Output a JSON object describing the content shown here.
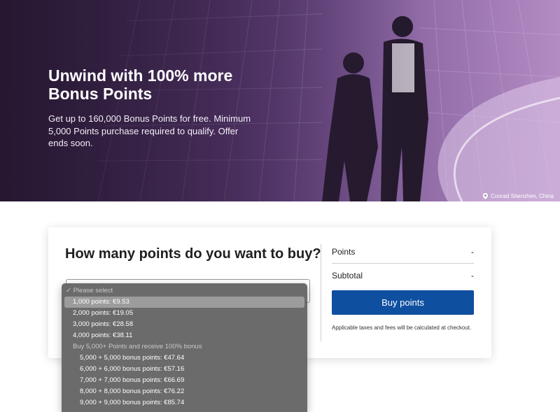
{
  "hero": {
    "title": "Unwind with 100% more Bonus Points",
    "body": "Get up to 160,000 Bonus Points for free. Minimum 5,000 Points purchase required to qualify. Offer ends soon.",
    "photo_credit": "Conrad Shenzhen, China"
  },
  "purchase": {
    "question": "How many points do you want to buy?",
    "summary": {
      "points_label": "Points",
      "points_value": "-",
      "subtotal_label": "Subtotal",
      "subtotal_value": "-"
    },
    "buy_button_label": "Buy points",
    "tax_note": "Applicable taxes and fees will be calculated at checkout."
  },
  "dropdown": {
    "placeholder": "✓ Please select",
    "options": [
      "1,000 points: €9.53",
      "2,000 points: €19.05",
      "3,000 points: €28.58",
      "4,000 points: €38.11"
    ],
    "group_label": "Buy 5,000+ Points and receive 100% bonus",
    "bonus_options": [
      "5,000 + 5,000 bonus points: €47.64",
      "6,000 + 6,000 bonus points: €57.16",
      "7,000 + 7,000 bonus points: €66.69",
      "8,000 + 8,000 bonus points: €76.22",
      "9,000 + 9,000 bonus points: €85.74"
    ]
  },
  "colors": {
    "primary_button": "#0f4fa0",
    "hero_tint": "#5a3a72",
    "dropdown_bg": "#6b6b6b"
  }
}
